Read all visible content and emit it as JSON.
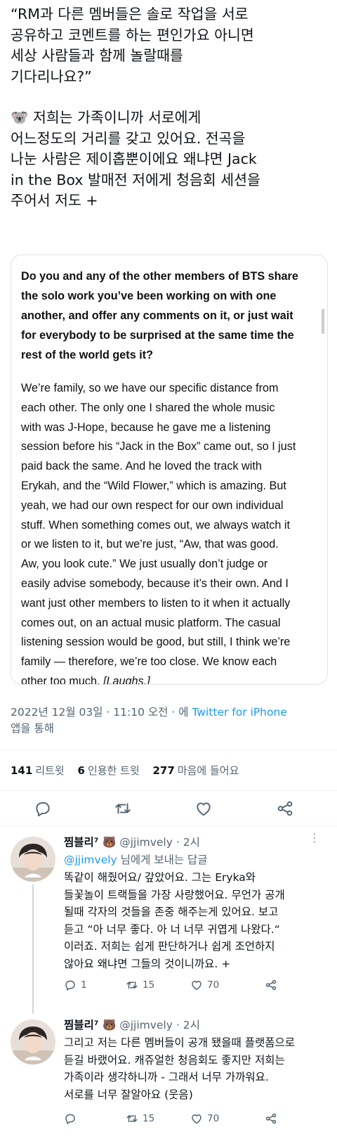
{
  "tweet": {
    "text_p1": "“RM과 다른 멤버들은 솔로 작업을 서로\n공유하고 코멘트를 하는 편인가요 아니면\n세상 사람들과 함께 놀랄때를\n기다리나요?”",
    "text_p2_emoji": "🐨",
    "text_p2": " 저희는 가족이니까 서로에게\n어느정도의 거리를 갖고 있어요. 전곡을\n나눈 사람은 제이홉뿐이에요 왜냐면 Jack\nin the Box 발매전 저에게 청음회 세션을\n주어서 저도 +",
    "quote": {
      "question": "Do you and any of the other members of BTS share\nthe solo work you’ve been working on with one\nanother, and offer any comments on it, or just wait\nfor everybody to be surprised at the same time the\nrest of the world gets it?",
      "answer": "We’re family, so we have our specific distance from\neach other. The only one I shared the whole music\nwith was J-Hope, because he gave me a listening\nsession before his “Jack in the Box” came out, so I just\npaid back the same. And he loved the track with\nErykah, and the “Wild Flower,” which is amazing. But\nyeah, we had our own respect for our own individual\nstuff. When something comes out, we always watch it\nor we listen to it, but we’re just, “Aw, that was good.\nAw, you look cute.” We just usually don’t judge or\neasily advise somebody, because it’s their own. And I\nwant just other members to listen to it when it actually\ncomes out, on an actual music platform. The casual\nlistening session would be good, but still, I think we’re\nfamily — therefore, we’re too close. We know each\nother too much. ",
      "answer_end": "[Laughs.]"
    },
    "meta_date": "2022년 12월 03일 · 11:10 오전 · 에 ",
    "meta_via": "Twitter for iPhone",
    "meta_via_suffix": "앱을 통해",
    "stats": {
      "retweets_count": "141",
      "retweets_label": "리트윗",
      "quotes_count": "6",
      "quotes_label": "인용한 트윗",
      "likes_count": "277",
      "likes_label": "마음에 들어요"
    },
    "icons": [
      "reply-icon",
      "retweet-icon",
      "like-icon",
      "share-icon"
    ]
  },
  "replies": [
    {
      "name": "찜블리⁷ 🐻",
      "handle": "@jjimvely",
      "time": "· 2시",
      "replying_to_handle": "@jjimvely",
      "replying_to_suffix": " 님에게 보내는 답글",
      "body": "똑같이 해줬어요/ 갚았어요. 그는 Eryka와\n들꽃놀이 트랙들을 가장 사랑했어요. 무언가 공개\n될때 각자의 것들을 존중 해주는게 있어요. 보고\n듣고 “아 너무 좋다. 아 너 너무 귀엽게 나왔다.“\n이러죠. 저희는 쉽게 판단하거나 쉽게 조언하지\n않아요 왜냐면 그들의 것이니까요. +",
      "reply_count": "1",
      "retweet_count": "15",
      "like_count": "70"
    },
    {
      "name": "찜블리⁷ 🐻",
      "handle": "@jjimvely",
      "time": "· 2시",
      "body": "그리고 저는 다른 멤버들이 공개 됐을때 플랫폼으로\n듣길 바랬어요. 캐쥬얼한 청음회도 좋지만 저희는\n가족이라 생각하니까 - 그래서 너무 가까워요.\n서로를 너무 잘알아요 (웃음)",
      "reply_count": "",
      "retweet_count": "15",
      "like_count": "70"
    }
  ],
  "colors": {
    "text": "#0f1419",
    "secondary": "#536471",
    "link": "#1d9bf0",
    "border": "#dfe3e7"
  }
}
